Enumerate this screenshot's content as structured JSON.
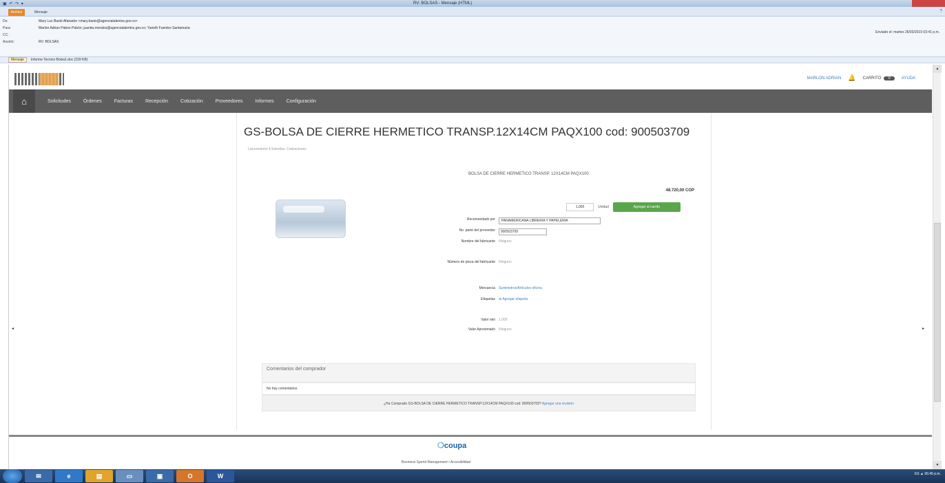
{
  "outlook": {
    "window_title": "RV: BOLSAS - Mensaje (HTML)",
    "file_tab": "Archivo",
    "message_tab": "Mensaje",
    "header_labels": {
      "from": "De:",
      "to": "Para:",
      "cc": "CC:",
      "subject": "Asunto:"
    },
    "from": "Mary Luz Bastó Afanador <mary.basto@agenciatalentos.gov.co>",
    "to": "Marlon Adrian Pabon Pabón; juanita.morales@agenciatalentos.gov.co; Yaneth Fuentes Santamaria",
    "subject": "RV: BOLSAS",
    "sent": "Enviado el: martes 26/03/2019 03:41 p.m.",
    "attach_message": "Mensaje",
    "attachment": "Informe Tecnico Bolsa1.doc (159 KB)"
  },
  "coupa": {
    "user_menu": "MARLON ADRIAN",
    "cart_label": "CARRITO",
    "cart_count": "0",
    "help": "AYUDA",
    "nav": [
      "Solicitudes",
      "Órdenes",
      "Facturas",
      "Recepción",
      "Cotización",
      "Proveedores",
      "Informes",
      "Configuración"
    ],
    "product": {
      "title": "GS-BOLSA DE CIERRE HERMETICO TRANSP.12X14CM PAQX100 cod: 900503709",
      "subtitle": "Lanzamiento 4 Estrellas: Cotizaciones",
      "description": "BOLSA DE CIERRE HERMETICO TRANSP. 12X14CM PAQX100",
      "price": "48.720,00 COP",
      "qty": "1,000",
      "unit": "Unidad",
      "add_to_cart": "Agregar al carrito",
      "fields": [
        {
          "label": "Recomendado por",
          "value": "PANAMERICANA LIBRERIA Y PAPELERIA",
          "kind": "select"
        },
        {
          "label": "No. parte del proveedor",
          "value": "900503709",
          "kind": "input"
        },
        {
          "label": "Nombre del fabricante",
          "value": "Ninguno",
          "kind": "text"
        },
        {
          "label": "Número de pieza del fabricante",
          "value": "Ninguno",
          "kind": "text"
        },
        {
          "label": "Mercancía",
          "value": "Suministros/Artículos oficina",
          "kind": "link"
        },
        {
          "label": "Etiquetas",
          "value": "Agregar etiqueta",
          "kind": "link"
        },
        {
          "label": "Valor min",
          "value": "1.000",
          "kind": "text"
        },
        {
          "label": "Valor Aproximado",
          "value": "Ninguno",
          "kind": "text"
        }
      ]
    },
    "comments": {
      "heading": "Comentarios del comprador",
      "empty": "No hay comentarios",
      "review_prompt": "¿Ha Comprado GS-BOLSA DE CIERRE HERMETICO TRANSP.12X14CM PAQX100 cod: 900503709?",
      "review_link": "Agregar una revisión"
    },
    "footer": {
      "brand": "coupa",
      "text": "Business Spend Management  •  Accesibilidad"
    }
  },
  "taskbar": {
    "tray": "ES  ▲  06:45 p.m."
  }
}
